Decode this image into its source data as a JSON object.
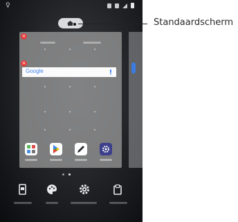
{
  "callout": {
    "label": "Standaardscherm"
  },
  "home_screen": {
    "search_bar": {
      "logo_text": "Google"
    },
    "apps": [
      {
        "name": "app-folder",
        "icon": "app-folder-icon"
      },
      {
        "name": "play-store",
        "icon": "play-store-icon"
      },
      {
        "name": "notes",
        "icon": "pen-icon"
      },
      {
        "name": "settings",
        "icon": "gear-icon"
      }
    ]
  },
  "bottom_menu": [
    {
      "icon": "widgets-icon"
    },
    {
      "icon": "palette-icon"
    },
    {
      "icon": "gear-icon"
    },
    {
      "icon": "wallpaper-icon"
    }
  ],
  "colors": {
    "remove_badge": "#e33d3d",
    "accent": "#3b7be0",
    "settings_icon_bg": "#3c3f8a"
  }
}
